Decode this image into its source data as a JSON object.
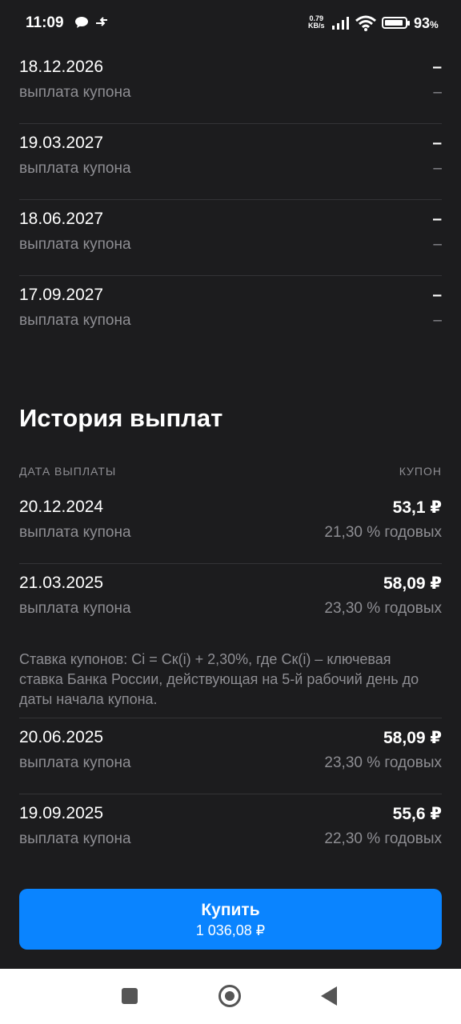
{
  "status_bar": {
    "time": "11:09",
    "speed_value": "0.79",
    "speed_unit": "KB/s",
    "battery_percent": "93",
    "battery_symbol": "%",
    "battery_level": 0.93
  },
  "schedule": [
    {
      "date": "18.12.2026",
      "type": "выплата купона",
      "amount": "–",
      "rate": "–"
    },
    {
      "date": "19.03.2027",
      "type": "выплата купона",
      "amount": "–",
      "rate": "–"
    },
    {
      "date": "18.06.2027",
      "type": "выплата купона",
      "amount": "–",
      "rate": "–"
    },
    {
      "date": "17.09.2027",
      "type": "выплата купона",
      "amount": "–",
      "rate": "–"
    }
  ],
  "history": {
    "title": "История выплат",
    "col_date": "ДАТА ВЫПЛАТЫ",
    "col_coupon": "КУПОН",
    "rows": [
      {
        "date": "20.12.2024",
        "type": "выплата купона",
        "amount": "53,1 ₽",
        "rate": "21,30 % годовых"
      },
      {
        "date": "21.03.2025",
        "type": "выплата купона",
        "amount": "58,09 ₽",
        "rate": "23,30 % годовых"
      },
      {
        "date": "20.06.2025",
        "type": "выплата купона",
        "amount": "58,09 ₽",
        "rate": "23,30 % годовых"
      },
      {
        "date": "19.09.2025",
        "type": "выплата купона",
        "amount": "55,6 ₽",
        "rate": "22,30 % годовых"
      }
    ],
    "note": "Ставка купонов: Ci = Cк(i) + 2,30%, где Cк(i) – ключевая ставка Банка России, действующая на 5-й рабочий день до даты начала купона."
  },
  "buy_button": {
    "label": "Купить",
    "price": "1 036,08 ₽",
    "color": "#0a84ff"
  },
  "nav": {
    "recents_icon": "square-icon",
    "home_icon": "circle-icon",
    "back_icon": "triangle-back-icon"
  }
}
